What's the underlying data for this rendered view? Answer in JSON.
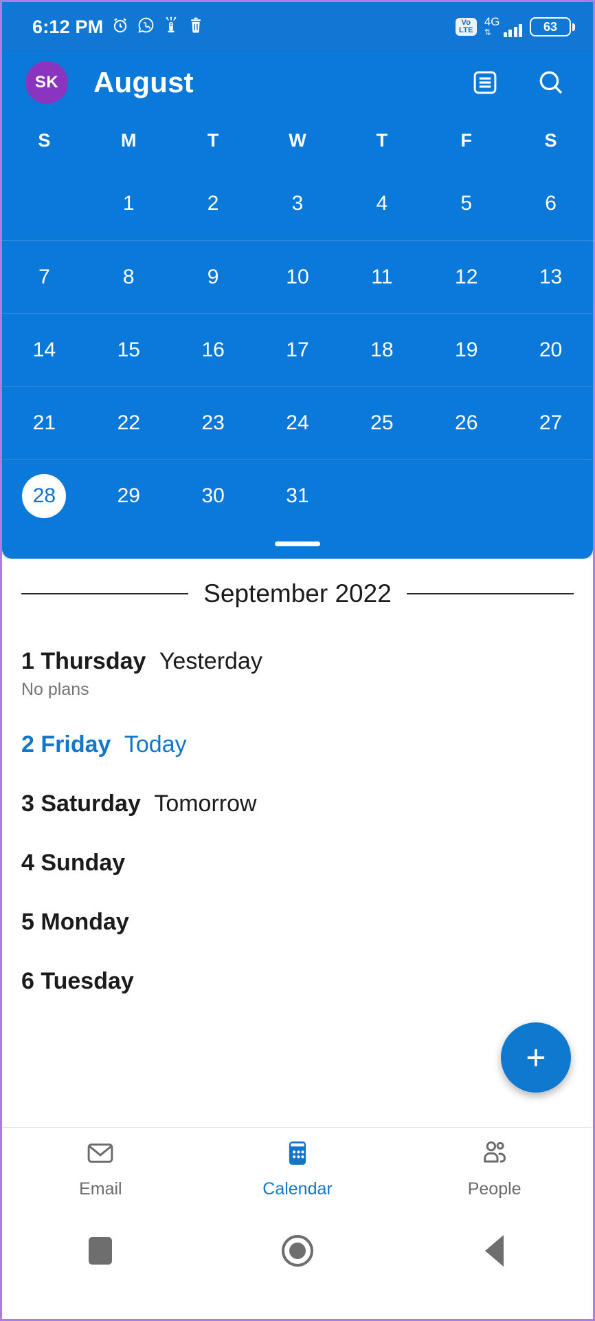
{
  "status_bar": {
    "time": "6:12 PM",
    "left_icons": [
      "alarm-clock-icon",
      "whatsapp-icon",
      "scooter-icon",
      "trash-icon"
    ],
    "volte_line1": "Vo",
    "volte_line2": "LTE",
    "network_type": "4G",
    "data_arrows": "⇅",
    "signal_bars": 4,
    "battery_percent": "63"
  },
  "app_bar": {
    "avatar_initials": "SK",
    "title": "August",
    "agenda_icon": "agenda-view-icon",
    "search_icon": "search-icon"
  },
  "calendar": {
    "weekday_headers": [
      "S",
      "M",
      "T",
      "W",
      "T",
      "F",
      "S"
    ],
    "selected_day": "28",
    "weeks": [
      [
        "",
        "1",
        "2",
        "3",
        "4",
        "5",
        "6"
      ],
      [
        "7",
        "8",
        "9",
        "10",
        "11",
        "12",
        "13"
      ],
      [
        "14",
        "15",
        "16",
        "17",
        "18",
        "19",
        "20"
      ],
      [
        "21",
        "22",
        "23",
        "24",
        "25",
        "26",
        "27"
      ],
      [
        "28",
        "29",
        "30",
        "31",
        "",
        "",
        ""
      ]
    ]
  },
  "agenda": {
    "month_label": "September 2022",
    "days": [
      {
        "num": "1",
        "weekday": "Thursday",
        "relative": "Yesterday",
        "note": "No plans",
        "today": false
      },
      {
        "num": "2",
        "weekday": "Friday",
        "relative": "Today",
        "note": "",
        "today": true
      },
      {
        "num": "3",
        "weekday": "Saturday",
        "relative": "Tomorrow",
        "note": "",
        "today": false
      },
      {
        "num": "4",
        "weekday": "Sunday",
        "relative": "",
        "note": "",
        "today": false
      },
      {
        "num": "5",
        "weekday": "Monday",
        "relative": "",
        "note": "",
        "today": false
      },
      {
        "num": "6",
        "weekday": "Tuesday",
        "relative": "",
        "note": "",
        "today": false
      }
    ],
    "fab_label": "+"
  },
  "bottom_nav": {
    "items": [
      {
        "label": "Email",
        "icon": "envelope-icon",
        "active": false
      },
      {
        "label": "Calendar",
        "icon": "calendar-icon",
        "active": true
      },
      {
        "label": "People",
        "icon": "people-icon",
        "active": false
      }
    ]
  },
  "system_nav": {
    "recents": "recents-square-icon",
    "home": "home-circle-icon",
    "back": "back-triangle-icon"
  },
  "colors": {
    "status_blue": "#1177d4",
    "header_blue": "#0b79d9",
    "accent_blue": "#1277c9",
    "avatar_purple": "#8b34c0"
  }
}
